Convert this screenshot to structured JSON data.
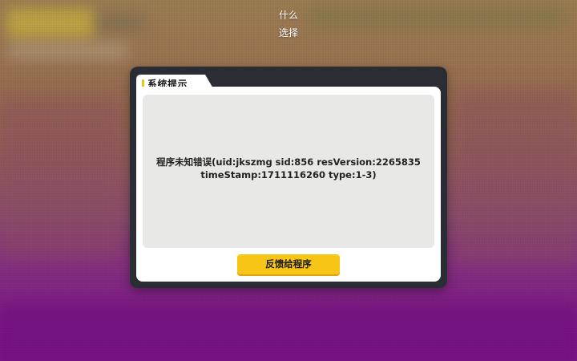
{
  "top_menu": {
    "line1": "什么",
    "line2": "选择"
  },
  "dialog": {
    "title": "系统提示",
    "message_line1": "程序未知错误(uid:jkszmg sid:856 resVersion:2265835",
    "message_line2": "timeStamp:1711116260 type:1-3)",
    "button_label": "反馈给程序"
  },
  "colors": {
    "accent_yellow": "#f6c516",
    "dialog_frame": "#2a2d33",
    "content_panel": "#e8e9e7"
  }
}
